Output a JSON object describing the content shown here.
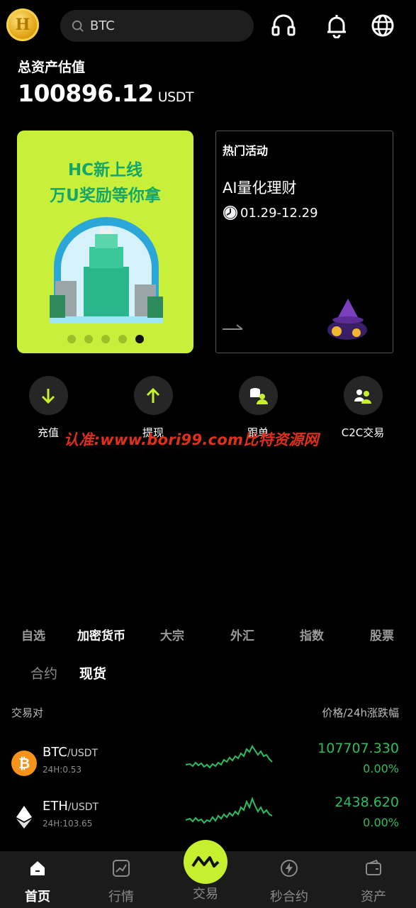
{
  "header": {
    "search_value": "BTC",
    "logo_letter": "H"
  },
  "assets": {
    "label": "总资产估值",
    "value": "100896.12",
    "unit": "USDT"
  },
  "banner": {
    "line1": "HC新上线",
    "line2": "万U奖励等你拿",
    "slide_count": 5,
    "active_slide": 5
  },
  "hot": {
    "heading": "热门活动",
    "name": "AI量化理财",
    "date": "01.29-12.29"
  },
  "actions": [
    {
      "label": "充值"
    },
    {
      "label": "提现"
    },
    {
      "label": "跟单"
    },
    {
      "label": "C2C交易"
    }
  ],
  "watermark": "认准:www.bori99.com比特资源网",
  "market_tabs": [
    "自选",
    "加密货币",
    "大宗",
    "外汇",
    "指数",
    "股票"
  ],
  "active_market_tab": "加密货币",
  "sub_tabs": [
    "合约",
    "现货"
  ],
  "active_sub_tab": "现货",
  "columns": {
    "left": "交易对",
    "right": "价格/24h涨跌幅"
  },
  "rows": [
    {
      "base": "BTC",
      "quote": "/USDT",
      "vol": "24H:0.53",
      "price": "107707.330",
      "change": "0.00%"
    },
    {
      "base": "ETH",
      "quote": "/USDT",
      "vol": "24H:103.65",
      "price": "2438.620",
      "change": "0.00%"
    }
  ],
  "nav": [
    {
      "label": "首页"
    },
    {
      "label": "行情"
    },
    {
      "label": "交易"
    },
    {
      "label": "秒合约"
    },
    {
      "label": "资产"
    }
  ],
  "colors": {
    "accent": "#c6f02e",
    "up": "#2ebd5f",
    "bg": "#000000"
  }
}
